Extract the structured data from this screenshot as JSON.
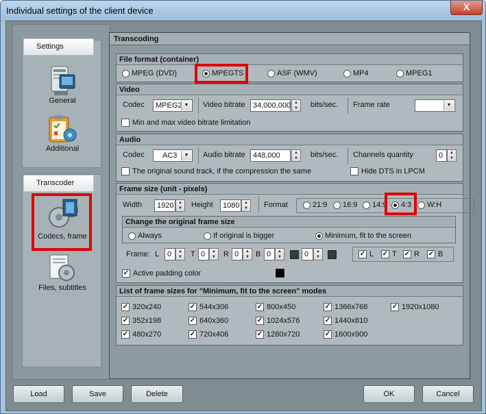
{
  "window": {
    "title": "Individual settings of the client device",
    "close_label": "X"
  },
  "sidebar": {
    "settings_header": "Settings",
    "general_label": "General",
    "additional_label": "Additional",
    "transcoder_header": "Transcoder",
    "codecs_label": "Codecs, frame",
    "files_label": "Files, subtitles"
  },
  "transcoding": {
    "title": "Transcoding",
    "file_format": {
      "title": "File format (container)",
      "options": [
        "MPEG (DVD)",
        "MPEGTS",
        "ASF (WMV)",
        "MP4",
        "MPEG1"
      ],
      "selected": "MPEGTS"
    },
    "video": {
      "title": "Video",
      "codec_label": "Codec",
      "codec_value": "MPEG2",
      "bitrate_label": "Video bitrate",
      "bitrate_value": "34,000,000",
      "bitrate_unit": "bits/sec.",
      "framerate_label": "Frame rate",
      "framerate_value": "",
      "minmax_label": "Min and max video bitrate limitation",
      "minmax_checked": false
    },
    "audio": {
      "title": "Audio",
      "codec_label": "Codec",
      "codec_value": "AC3",
      "bitrate_label": "Audio bitrate",
      "bitrate_value": "448,000",
      "bitrate_unit": "bits/sec.",
      "channels_label": "Channels quantity",
      "channels_value": "0",
      "original_track_label": "The original sound track, if the compression the same",
      "original_track_checked": false,
      "hide_dts_label": "Hide DTS in LPCM",
      "hide_dts_checked": false
    },
    "frame_size": {
      "title": "Frame size (unit - pixels)",
      "width_label": "Width",
      "width_value": "1920",
      "height_label": "Height",
      "height_value": "1080",
      "format_label": "Format",
      "formats": [
        "21:9",
        "16:9",
        "14:9",
        "4:3",
        "W:H"
      ],
      "selected_format": "4:3",
      "change_title": "Change the original frame size",
      "change_options": [
        "Always",
        "If original is bigger",
        "Minimum, fit to the screen"
      ],
      "change_selected": "Minimum, fit to the screen",
      "frame_label": "Frame:",
      "sides": [
        {
          "label": "L",
          "value": "0"
        },
        {
          "label": "T",
          "value": "0"
        },
        {
          "label": "R",
          "value": "0"
        },
        {
          "label": "B",
          "value": "0"
        }
      ],
      "extra_value": "0",
      "side_checks": [
        {
          "label": "L",
          "checked": true
        },
        {
          "label": "T",
          "checked": true
        },
        {
          "label": "R",
          "checked": true
        },
        {
          "label": "B",
          "checked": true
        }
      ],
      "padding_label": "Active padding color",
      "padding_checked": true,
      "padding_color": "#000000"
    },
    "frame_list": {
      "title": "List of frame sizes for \"Minimum, fit to the screen\" modes",
      "columns": [
        [
          "320x240",
          "352x198",
          "480x270"
        ],
        [
          "544x306",
          "640x360",
          "720x406"
        ],
        [
          "800x450",
          "1024x576",
          "1280x720"
        ],
        [
          "1366x768",
          "1440x810",
          "1600x900"
        ],
        [
          "1920x1080"
        ]
      ]
    }
  },
  "buttons": {
    "load": "Load",
    "save": "Save",
    "delete": "Delete",
    "ok": "OK",
    "cancel": "Cancel"
  },
  "colors": {
    "highlight": "#e00000",
    "window_frame": "#a8c4dc",
    "panel": "#8d9a9f"
  }
}
